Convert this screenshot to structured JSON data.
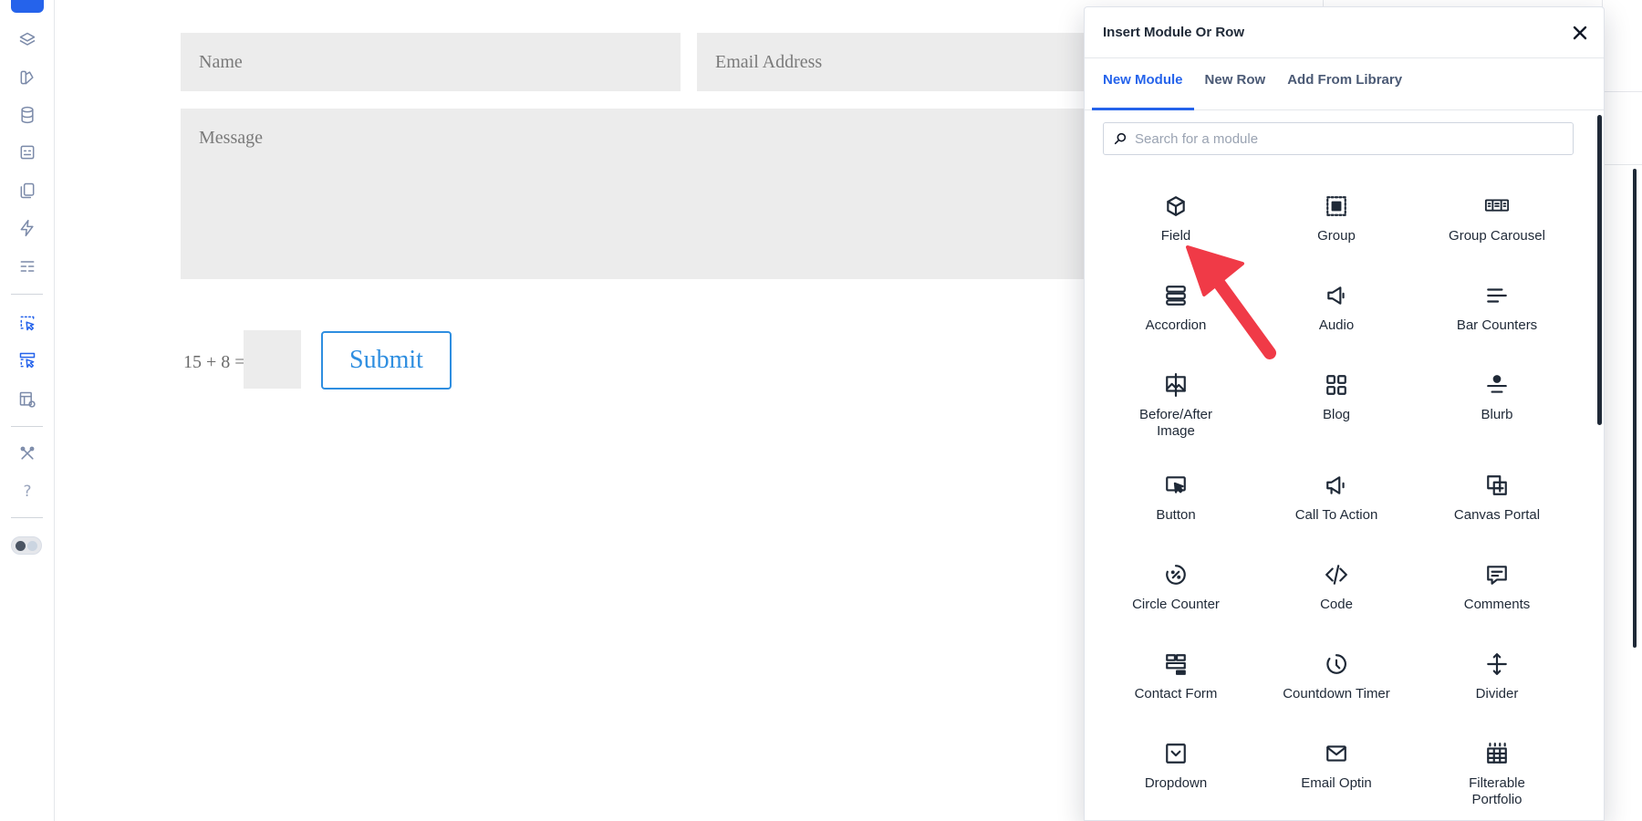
{
  "form": {
    "name_placeholder": "Name",
    "email_placeholder": "Email Address",
    "message_placeholder": "Message",
    "captcha_label": "15 + 8 =",
    "submit_label": "Submit"
  },
  "dialog": {
    "title": "Insert Module Or Row",
    "tabs": [
      "New Module",
      "New Row",
      "Add From Library"
    ],
    "search_placeholder": "Search for a module",
    "modules": [
      "Field",
      "Group",
      "Group Carousel",
      "Accordion",
      "Audio",
      "Bar Counters",
      "Before/After Image",
      "Blog",
      "Blurb",
      "Button",
      "Call To Action",
      "Canvas Portal",
      "Circle Counter",
      "Code",
      "Comments",
      "Contact Form",
      "Countdown Timer",
      "Divider",
      "Dropdown",
      "Email Optin",
      "Filterable Portfolio"
    ]
  },
  "sidebar": {
    "icons": [
      "layers-icon",
      "theme-icon",
      "database-icon",
      "form-icon",
      "pages-icon",
      "lightning-icon",
      "layout-icon",
      "insert-module-icon",
      "insert-row-icon",
      "preview-icon",
      "tools-icon",
      "help-icon",
      "theme-toggle"
    ],
    "help_glyph": "?"
  },
  "colors": {
    "accent": "#2563eb",
    "submit": "#2e8ee0",
    "field_bg": "#ececec",
    "annotation_arrow": "#f03a47"
  }
}
